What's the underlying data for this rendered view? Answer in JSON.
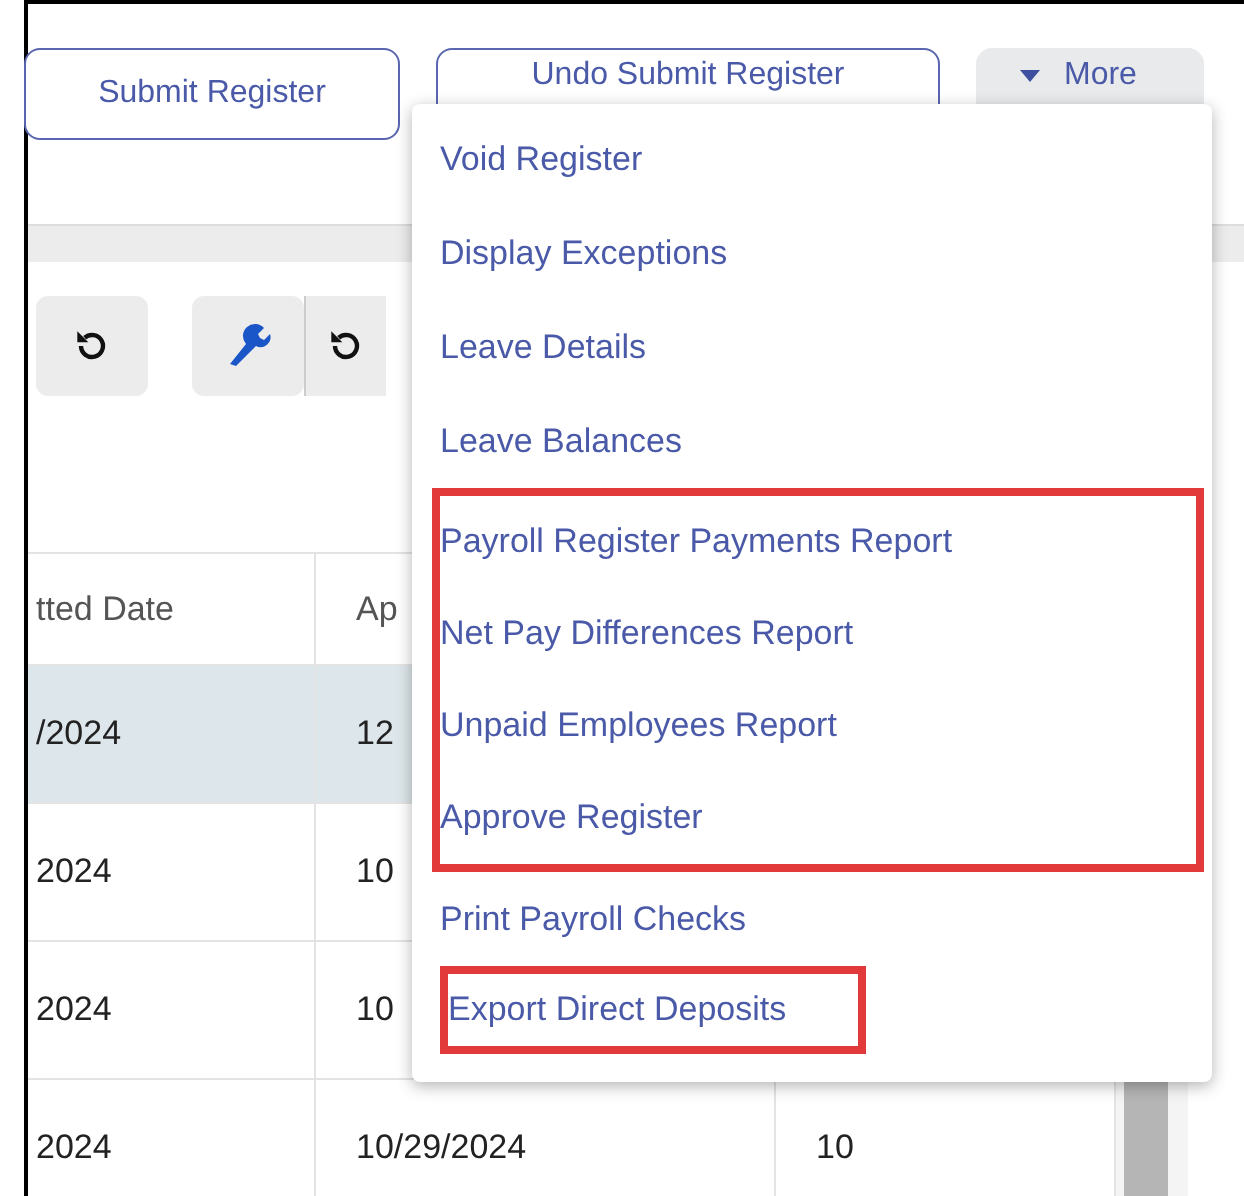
{
  "toolbar": {
    "buttons": [
      {
        "label": "Submit Register",
        "kind": "outline"
      },
      {
        "label": "Undo Submit Register",
        "kind": "outline"
      },
      {
        "label": "More",
        "kind": "menu"
      }
    ]
  },
  "tool_icons": [
    {
      "kind": "refresh"
    },
    {
      "kind": "wrench"
    },
    {
      "kind": "refresh"
    }
  ],
  "table": {
    "columns": [
      "tted Date",
      "Ap",
      ""
    ],
    "rows": [
      {
        "selected": true,
        "cells": [
          "/2024",
          "12",
          ""
        ]
      },
      {
        "selected": false,
        "cells": [
          "2024",
          "10",
          ""
        ]
      },
      {
        "selected": false,
        "cells": [
          "2024",
          "10",
          ""
        ]
      },
      {
        "selected": false,
        "cells": [
          "2024",
          "10/29/2024",
          "10"
        ]
      }
    ]
  },
  "menu": {
    "groups": [
      {
        "highlighted": false,
        "items": [
          "Void Register",
          "Display Exceptions",
          "Leave Details",
          "Leave Balances"
        ]
      },
      {
        "highlighted": true,
        "items": [
          "Payroll Register Payments Report",
          "Net Pay Differences Report",
          "Unpaid Employees Report",
          "Approve Register"
        ]
      },
      {
        "highlighted": false,
        "items": [
          "Print Payroll Checks"
        ]
      },
      {
        "highlighted": true,
        "items": [
          "Export Direct Deposits"
        ]
      }
    ]
  }
}
